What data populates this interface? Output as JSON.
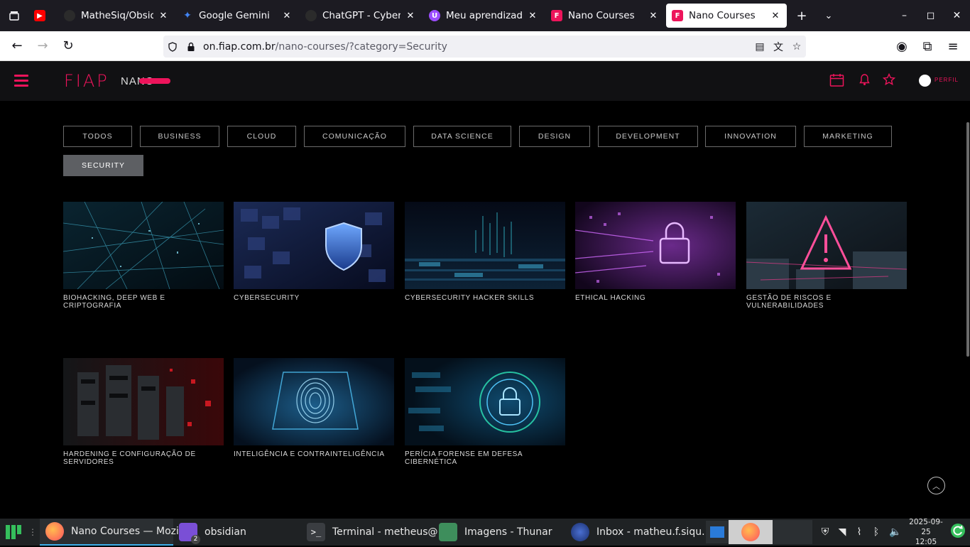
{
  "browser": {
    "tabs": [
      {
        "title": "",
        "favicon": "youtube-icon",
        "color": "#ff0000",
        "active": false
      },
      {
        "title": "MatheSiq/Obsidian",
        "favicon": "github-icon",
        "color": "#2b2b2b",
        "active": false
      },
      {
        "title": "Google Gemini",
        "favicon": "gemini-icon",
        "color": "#4285f4",
        "active": false
      },
      {
        "title": "ChatGPT - Cyberse",
        "favicon": "chatgpt-icon",
        "color": "#2b2b2b",
        "active": false
      },
      {
        "title": "Meu aprendizado",
        "favicon": "course-icon",
        "color": "#9b4dff",
        "active": false
      },
      {
        "title": "Nano Courses",
        "favicon": "fiap-icon",
        "color": "#ed145b",
        "active": false
      },
      {
        "title": "Nano Courses",
        "favicon": "fiap-icon",
        "color": "#ed145b",
        "active": true
      }
    ],
    "url_host": "on.fiap.com.br",
    "url_path": "/nano-courses/?category=Security"
  },
  "site": {
    "profile_label": "PERFIL",
    "filters": [
      "TODOS",
      "BUSINESS",
      "CLOUD",
      "COMUNICAÇÃO",
      "DATA SCIENCE",
      "DESIGN",
      "DEVELOPMENT",
      "INNOVATION",
      "MARKETING",
      "SECURITY"
    ],
    "active_filter": "SECURITY",
    "courses": [
      "BIOHACKING, DEEP WEB E CRIPTOGRAFIA",
      "CYBERSECURITY",
      "CYBERSECURITY HACKER SKILLS",
      "ETHICAL HACKING",
      "GESTÃO DE RISCOS E VULNERABILIDADES",
      "HARDENING E CONFIGURAÇÃO DE SERVIDORES",
      "INTELIGÊNCIA E CONTRAINTELIGÊNCIA",
      "PERÍCIA FORENSE EM DEFESA CIBERNÉTICA"
    ]
  },
  "taskbar": {
    "items": [
      {
        "label": "Nano Courses — Mozi...",
        "icon": "firefox-icon",
        "active": true
      },
      {
        "label": "obsidian",
        "icon": "obsidian-icon",
        "badge": "2",
        "active": false
      },
      {
        "label": "Terminal - metheus@...",
        "icon": "terminal-icon",
        "active": false
      },
      {
        "label": "Imagens - Thunar",
        "icon": "folder-icon",
        "active": false
      },
      {
        "label": "Inbox - matheu.f.siqu...",
        "icon": "thunderbird-icon",
        "active": false
      }
    ],
    "date": "2025-09-25",
    "time": "12:05"
  },
  "colors": {
    "brand": "#ed145b",
    "background": "#000000",
    "header": "#111113"
  }
}
